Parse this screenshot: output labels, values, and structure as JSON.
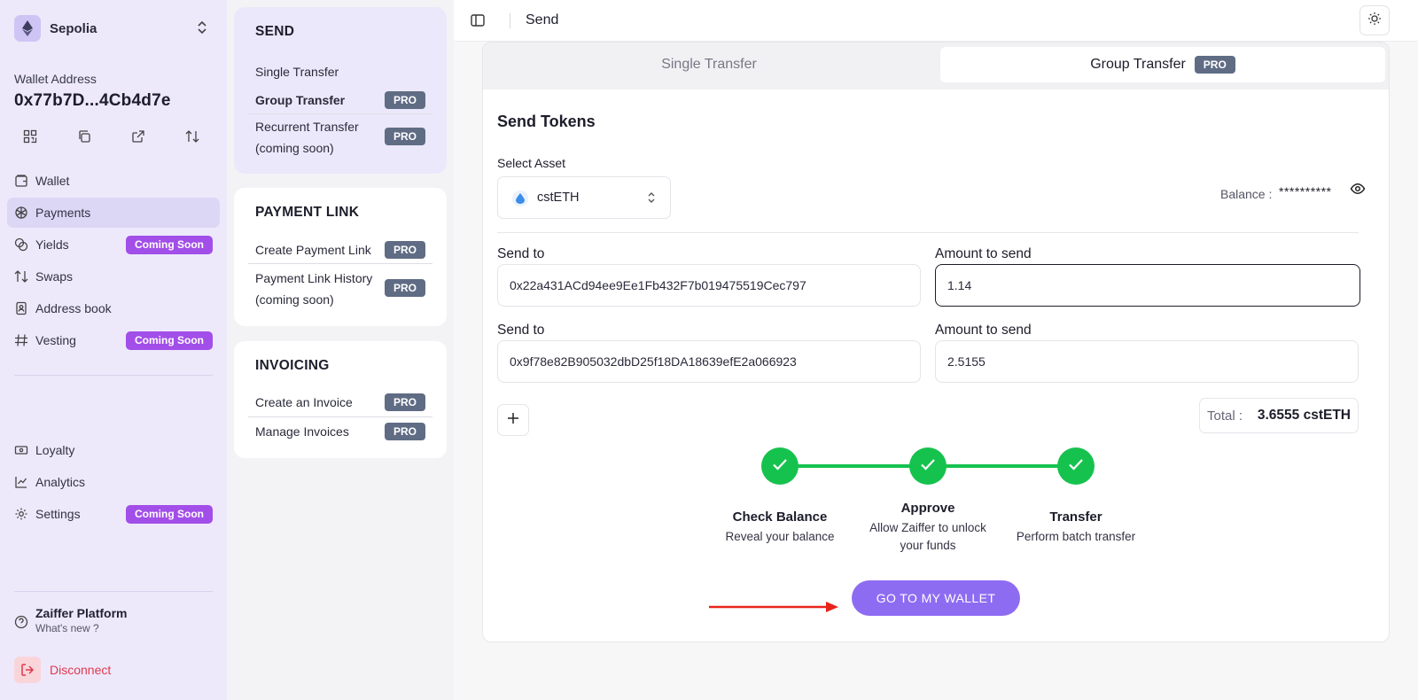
{
  "sidebar": {
    "network": "Sepolia",
    "wallet_address_label": "Wallet Address",
    "wallet_address": "0x77b7D...4Cb4d7e",
    "nav": [
      {
        "label": "Wallet"
      },
      {
        "label": "Payments"
      },
      {
        "label": "Yields",
        "badge": "Coming Soon"
      },
      {
        "label": "Swaps"
      },
      {
        "label": "Address book"
      },
      {
        "label": "Vesting",
        "badge": "Coming Soon"
      },
      {
        "label": "Loyalty"
      },
      {
        "label": "Analytics"
      },
      {
        "label": "Settings",
        "badge": "Coming Soon"
      }
    ],
    "platform_title": "Zaiffer Platform",
    "platform_subtitle": "What's new ?",
    "disconnect": "Disconnect"
  },
  "menu": {
    "send": {
      "title": "SEND",
      "items": [
        {
          "label": "Single Transfer"
        },
        {
          "label": "Group Transfer",
          "badge": "PRO"
        },
        {
          "label_line1": "Recurrent Transfer",
          "label_line2": "(coming soon)",
          "badge": "PRO"
        }
      ]
    },
    "payment_link": {
      "title": "PAYMENT LINK",
      "items": [
        {
          "label": "Create Payment Link",
          "badge": "PRO"
        },
        {
          "label_line1": "Payment Link History",
          "label_line2": "(coming soon)",
          "badge": "PRO"
        }
      ]
    },
    "invoicing": {
      "title": "INVOICING",
      "items": [
        {
          "label": "Create an Invoice",
          "badge": "PRO"
        },
        {
          "label": "Manage Invoices",
          "badge": "PRO"
        }
      ]
    }
  },
  "topbar": {
    "title": "Send"
  },
  "tabs": {
    "single": "Single Transfer",
    "group": "Group Transfer",
    "group_badge": "PRO"
  },
  "form": {
    "title": "Send Tokens",
    "select_asset_label": "Select Asset",
    "asset": "cstETH",
    "balance_label": "Balance :",
    "balance_value": "**********",
    "rows": [
      {
        "send_to_label": "Send to",
        "address": "0x22a431ACd94ee9Ee1Fb432F7b019475519Cec797",
        "amount_label": "Amount to send",
        "amount": "1.14"
      },
      {
        "send_to_label": "Send to",
        "address": "0x9f78e82B905032dbD25f18DA18639efE2a066923",
        "amount_label": "Amount to send",
        "amount": "2.5155"
      }
    ],
    "total_label": "Total :",
    "total_value": "3.6555 cstETH"
  },
  "steps": [
    {
      "title": "Check Balance",
      "subtitle_line1": "Reveal your balance",
      "status": "complete"
    },
    {
      "title": "Approve",
      "subtitle_line1": "Allow Zaiffer to unlock",
      "subtitle_line2": "your funds",
      "status": "complete"
    },
    {
      "title": "Transfer",
      "subtitle_line1": "Perform batch transfer",
      "status": "complete"
    }
  ],
  "cta": {
    "label": "GO TO MY WALLET"
  },
  "colors": {
    "sidebar_bg": "#ede9fb",
    "accent_purple": "#8e6cf2",
    "coming_soon": "#a24ee8",
    "pro_badge": "#5f6c84",
    "step_green": "#16c24e",
    "disconnect_red": "#e0384e",
    "annotation_arrow": "#e8231a"
  }
}
